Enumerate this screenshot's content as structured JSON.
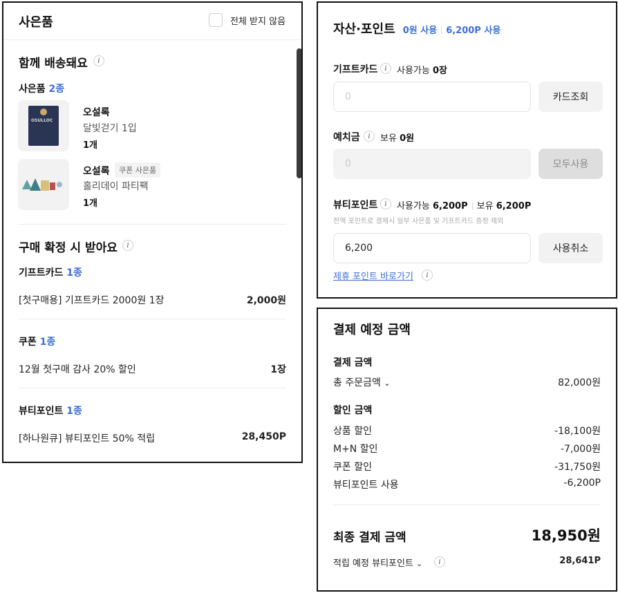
{
  "gift": {
    "title": "사은품",
    "opt_out_label": "전체 받지 않음",
    "ship_together": {
      "heading": "함께 배송돼요",
      "items_label": "사은품",
      "items_count": "2종",
      "items": [
        {
          "brand": "오설록",
          "name": "달빛걷기 1입",
          "qty": "1개",
          "badge": ""
        },
        {
          "brand": "오설록",
          "name": "홀리데이 파티팩",
          "qty": "1개",
          "badge": "쿠폰 사은품"
        }
      ],
      "thumb_text": "OSULLOC"
    },
    "on_confirm": {
      "heading": "구매 확정 시 받아요",
      "giftcard": {
        "label": "기프트카드",
        "count": "1종",
        "item": "[첫구매용] 기프트카드 2000원 1장",
        "value": "2,000원"
      },
      "coupon": {
        "label": "쿠폰",
        "count": "1종",
        "item": "12월 첫구매 감사 20% 할인",
        "value": "1장"
      },
      "beauty": {
        "label": "뷰티포인트",
        "count": "1종",
        "item": "[하나원큐] 뷰티포인트 50% 적립",
        "value": "28,450P"
      }
    }
  },
  "assets": {
    "title": "자산·포인트",
    "summary_a": "0원 사용",
    "summary_b": "6,200P 사용",
    "giftcard": {
      "label": "기프트카드",
      "avail_label": "사용가능",
      "avail_value": "0장",
      "placeholder": "0",
      "button": "카드조회"
    },
    "deposit": {
      "label": "예치금",
      "own_label": "보유",
      "own_value": "0원",
      "placeholder": "0",
      "button": "모두사용"
    },
    "beauty": {
      "label": "뷰티포인트",
      "avail_label": "사용가능",
      "avail_value": "6,200P",
      "own_label": "보유",
      "own_value": "6,200P",
      "note": "전액 포인트로 결제시 일부 사은품 및 기프트카드 증정 제외",
      "value": "6,200",
      "button": "사용취소"
    },
    "partner_link": "제휴 포인트 바로가기"
  },
  "payment": {
    "title": "결제 예정 금액",
    "pay_heading": "결제 금액",
    "total_label": "총 주문금액",
    "total_value": "82,000원",
    "discount_heading": "할인 금액",
    "discounts": [
      {
        "label": "상품 할인",
        "value": "-18,100원"
      },
      {
        "label": "M+N 할인",
        "value": "-7,000원"
      },
      {
        "label": "쿠폰 할인",
        "value": "-31,750원"
      },
      {
        "label": "뷰티포인트 사용",
        "value": "-6,200P"
      }
    ],
    "final_label": "최종 결제 금액",
    "final_value": "18,950원",
    "earn_label": "적립 예정 뷰티포인트",
    "earn_value": "28,641P"
  },
  "colors": {
    "accent_blue": "#3d6fd6",
    "discount_red": "#e9514e"
  }
}
